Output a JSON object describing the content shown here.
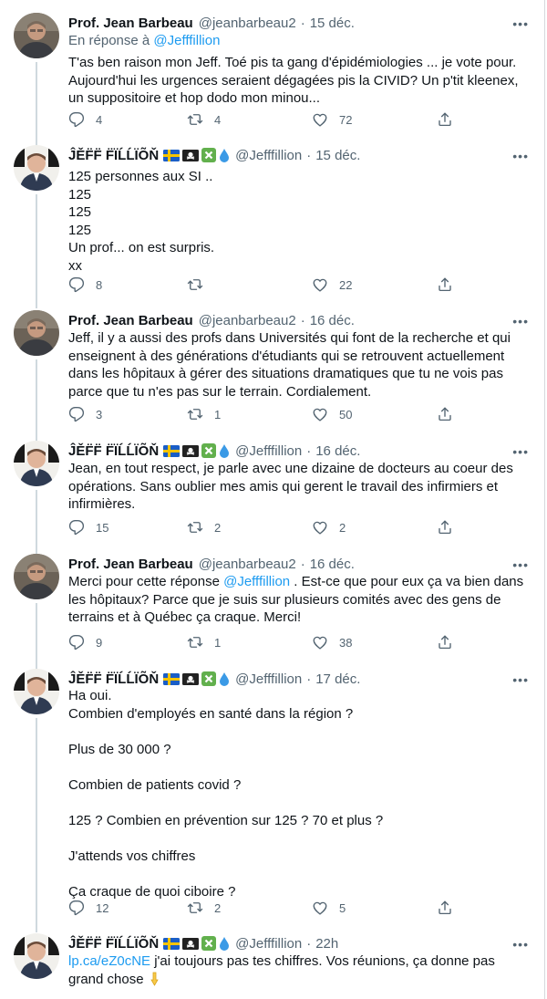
{
  "colors": {
    "accent": "#1d9bf0",
    "muted": "#536471",
    "text": "#0f1419",
    "thread": "#cfd9de"
  },
  "authors": {
    "jean": {
      "name": "Prof. Jean Barbeau",
      "handle": "@jeanbarbeau2"
    },
    "jeff": {
      "name": "ĴĚF̈F̈ F̈ÏĹĹÏÕŇ",
      "handle": "@Jefffillion",
      "badges": [
        "flag-sweden-icon",
        "pirate-flag-icon",
        "cross-mark-icon",
        "droplet-icon"
      ]
    }
  },
  "tweets": [
    {
      "date": "15 déc.",
      "reply_prefix": "En réponse à",
      "reply_to": "@Jefffillion",
      "text": "T'as ben raison mon Jeff. Toé pis ta gang d'épidémiologies ... je vote pour. Aujourd'hui les urgences seraient dégagées pis la CIVID? Un p'tit kleenex, un suppositoire et hop dodo mon minou...",
      "replies": "4",
      "retweets": "4",
      "likes": "72"
    },
    {
      "date": "15 déc.",
      "text": "125 personnes aux SI ..\n125\n125\n125\nUn prof... on est surpris.\nxx",
      "replies": "8",
      "retweets": "",
      "likes": "22"
    },
    {
      "date": "16 déc.",
      "text": "Jeff, il y a aussi des profs dans Universités qui font de la recherche et qui enseignent à des générations d'étudiants qui se retrouvent actuellement dans les hôpitaux à gérer des situations dramatiques que tu ne vois pas parce que tu n'es pas sur le terrain. Cordialement.",
      "replies": "3",
      "retweets": "1",
      "likes": "50"
    },
    {
      "date": "16 déc.",
      "text": "Jean, en tout respect, je parle avec une dizaine de docteurs au coeur des opérations. Sans oublier mes amis qui gerent le travail des infirmiers et infirmières.",
      "replies": "15",
      "retweets": "2",
      "likes": "2"
    },
    {
      "date": "16 déc.",
      "text_a": "Merci pour cette réponse ",
      "mention": "@Jefffillion",
      "text_b": " . Est-ce que pour eux ça va bien dans les hôpitaux? Parce que je suis sur plusieurs comités avec des gens de terrains et à Québec ça craque. Merci!",
      "replies": "9",
      "retweets": "1",
      "likes": "38"
    },
    {
      "date": "17 déc.",
      "text": "Ha oui.\nCombien d'employés en santé dans la région ?\n\nPlus de 30 000 ?\n\nCombien de patients covid ?\n\n125 ? Combien en prévention sur 125  ? 70 et plus ?\n\nJ'attends vos chiffres\n\nÇa craque de quoi ciboire ?",
      "replies": "12",
      "retweets": "2",
      "likes": "5"
    },
    {
      "date": "22h",
      "link": "lp.ca/eZ0cNE",
      "text": " j'ai toujours pas tes chiffres. Vos réunions, ça donne pas grand chose ",
      "emoji": "pointing-down-icon"
    }
  ]
}
